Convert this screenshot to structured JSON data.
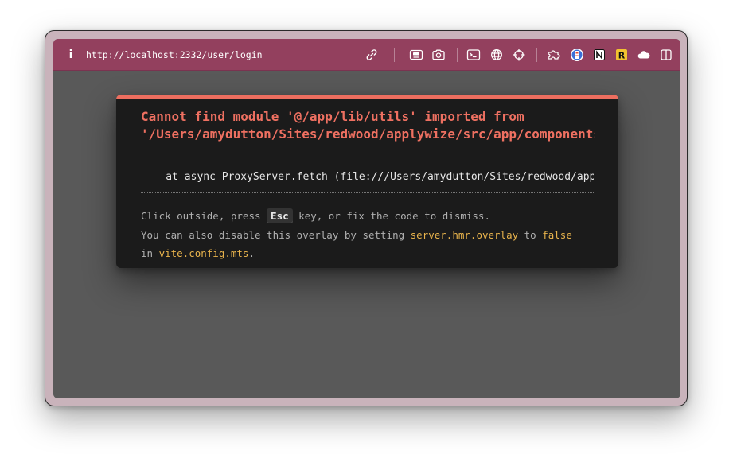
{
  "toolbar": {
    "info_icon": "i",
    "url": "http://localhost:2332/user/login"
  },
  "icons": [
    "link-icon",
    "picture-in-picture-icon",
    "camera-icon",
    "terminal-icon",
    "globe-icon",
    "crosshair-icon",
    "extensions-icon",
    "lighthouse-icon",
    "notion-icon",
    "r-extension-icon",
    "cloud-icon",
    "sidebar-icon"
  ],
  "overlay": {
    "message_line1": "Cannot find module '@/app/lib/utils' imported from",
    "message_line2": "'/Users/amydutton/Sites/redwood/applywize/src/app/components/",
    "stack_prefix": "    at async ProxyServer.fetch (file:",
    "stack_link": "///Users/amydutton/Sites/redwood/applywize/node_modules/",
    "tip_part1": "Click outside, press ",
    "tip_key": "Esc",
    "tip_part2": " key, or fix the code to dismiss.",
    "tip_part3": "You can also disable this overlay by setting ",
    "tip_code1": "server.hmr.overlay",
    "tip_part4": " to ",
    "tip_code2": "false",
    "tip_part5": "in ",
    "tip_code3": "vite.config.mts",
    "tip_part6": "."
  },
  "colors": {
    "toolbar": "#93405e",
    "overlay_accent": "#ed6e5f",
    "error_text": "#ee7061",
    "code_highlight": "#e8b34c",
    "overlay_bg": "#1b1b1b",
    "viewport_bg": "#595959"
  }
}
